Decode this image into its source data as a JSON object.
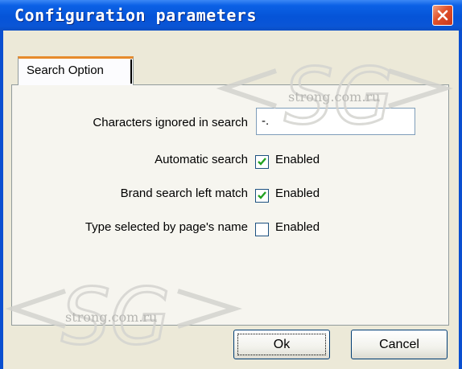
{
  "window": {
    "title": "Configuration parameters",
    "close_icon": "close-icon"
  },
  "tabs": [
    {
      "label": "Search Option",
      "active": true
    }
  ],
  "form": {
    "ignored_chars": {
      "label": "Characters ignored in search",
      "value": "-."
    },
    "automatic_search": {
      "label": "Automatic search",
      "checkbox_text": "Enabled",
      "checked": true
    },
    "brand_search": {
      "label": "Brand search left match",
      "checkbox_text": "Enabled",
      "checked": true
    },
    "type_selected": {
      "label": "Type selected by page's name",
      "checkbox_text": "Enabled",
      "checked": false
    }
  },
  "buttons": {
    "ok": "Ok",
    "cancel": "Cancel"
  },
  "watermark": {
    "logo_text": "SG",
    "site_text": "strong.com.ru"
  },
  "colors": {
    "titlebar": "#0554d8",
    "close": "#e0502a",
    "tab_highlight": "#e68b2c",
    "face": "#ece9d8"
  }
}
